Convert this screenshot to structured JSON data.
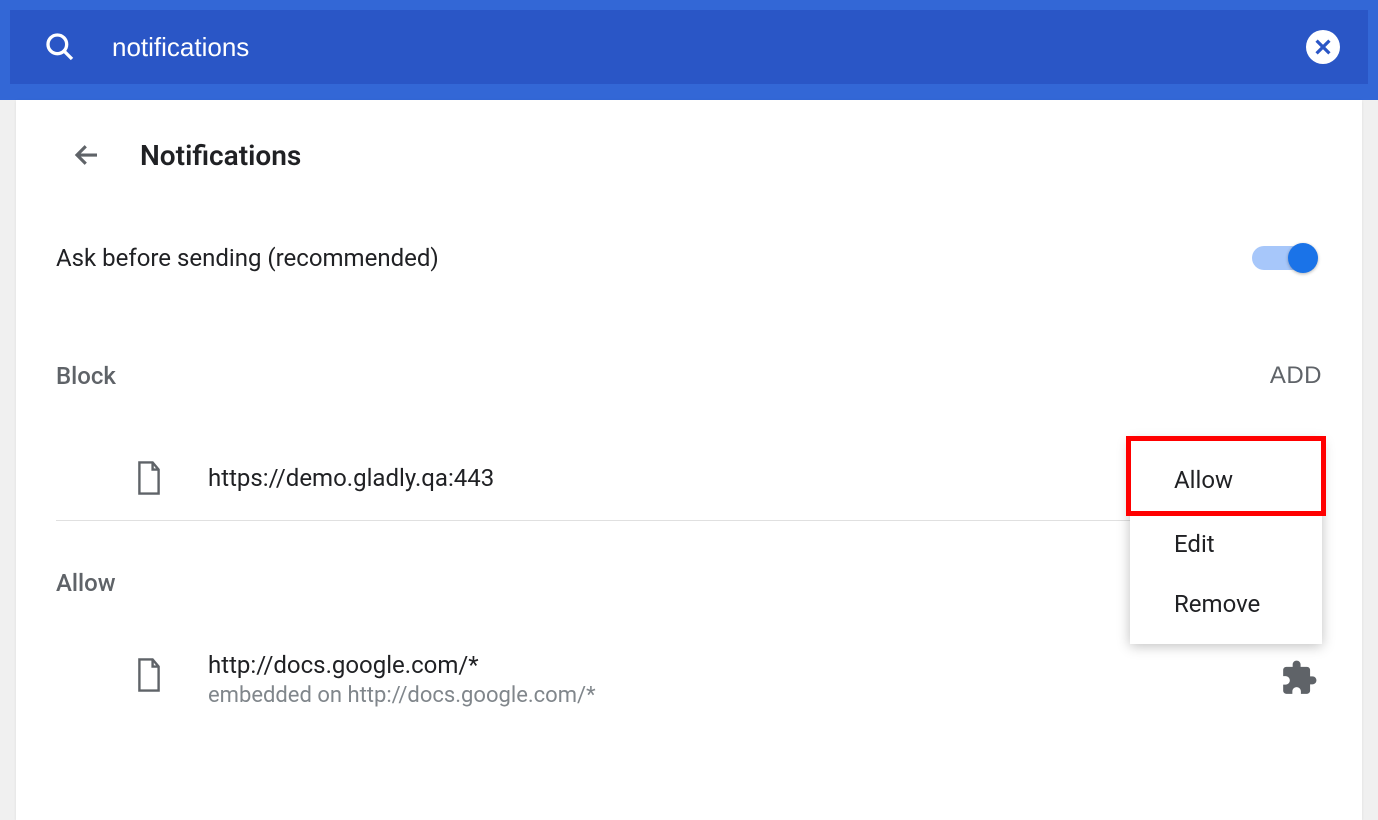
{
  "search": {
    "value": "notifications"
  },
  "header": {
    "title": "Notifications"
  },
  "ask": {
    "label": "Ask before sending (recommended)",
    "enabled": true
  },
  "sections": {
    "block": {
      "label": "Block",
      "add_label": "ADD",
      "items": [
        {
          "url": "https://demo.gladly.qa:443"
        }
      ]
    },
    "allow": {
      "label": "Allow",
      "items": [
        {
          "url": "http://docs.google.com/*",
          "sub": "embedded on http://docs.google.com/*"
        }
      ]
    }
  },
  "menu": {
    "allow": "Allow",
    "edit": "Edit",
    "remove": "Remove"
  }
}
